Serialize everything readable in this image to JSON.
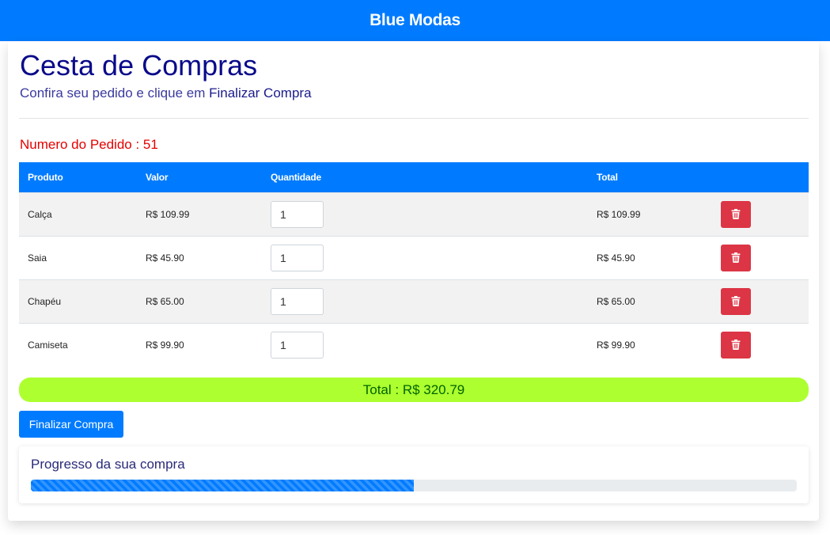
{
  "navbar": {
    "brand": "Blue Modas"
  },
  "header": {
    "title": "Cesta de Compras",
    "subtitle_prefix": "Confira seu pedido e clique em ",
    "subtitle_action": "Finalizar Compra"
  },
  "order": {
    "label": "Numero do Pedido : 51"
  },
  "table": {
    "columns": [
      "Produto",
      "Valor",
      "Quantidade",
      "Total"
    ],
    "rows": [
      {
        "product": "Calça",
        "price": "R$ 109.99",
        "quantity": "1",
        "total": "R$ 109.99"
      },
      {
        "product": "Saia",
        "price": "R$ 45.90",
        "quantity": "1",
        "total": "R$ 45.90"
      },
      {
        "product": "Chapéu",
        "price": "R$ 65.00",
        "quantity": "1",
        "total": "R$ 65.00"
      },
      {
        "product": "Camiseta",
        "price": "R$ 99.90",
        "quantity": "1",
        "total": "R$ 99.90"
      }
    ],
    "delete_icon": "trash-icon"
  },
  "summary": {
    "total_label": "Total : R$ 320.79"
  },
  "actions": {
    "finalize_label": "Finalizar Compra"
  },
  "progress": {
    "label": "Progresso da sua compra",
    "percent": 50
  },
  "colors": {
    "primary": "#007bff",
    "danger": "#dc3545",
    "total_bar": "#adff2f",
    "order_number": "#e60000",
    "title": "#0a0a8a"
  }
}
